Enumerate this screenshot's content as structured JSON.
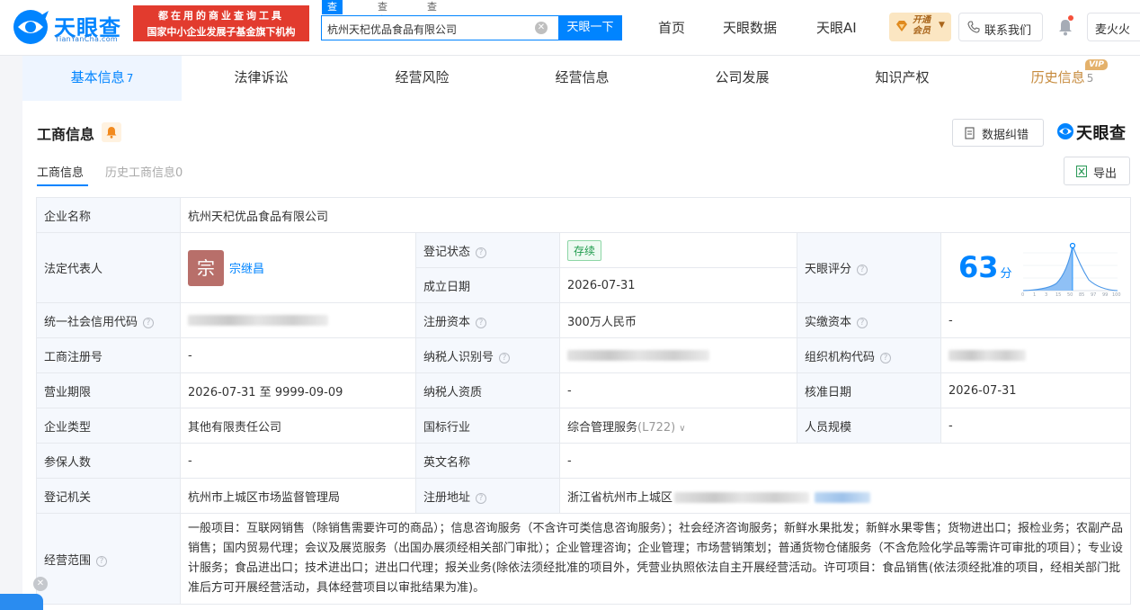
{
  "header": {
    "logo_text": "天眼查",
    "logo_sub": "TianYanCha.com",
    "slogan_line1": "都在用的商业查询工具",
    "slogan_line2": "国家中小企业发展子基金旗下机构",
    "search_tabs": [
      "查公司",
      "查老板",
      "查关系"
    ],
    "search_value": "杭州天杞优品食品有限公司",
    "search_button": "天眼一下",
    "nav": [
      "首页",
      "天眼数据",
      "天眼AI"
    ],
    "vip_label": "开通会员",
    "contact": "联系我们",
    "user": "麦火火"
  },
  "tabs": [
    {
      "label": "基本信息",
      "count": "7"
    },
    {
      "label": "法律诉讼",
      "count": ""
    },
    {
      "label": "经营风险",
      "count": ""
    },
    {
      "label": "经营信息",
      "count": ""
    },
    {
      "label": "公司发展",
      "count": ""
    },
    {
      "label": "知识产权",
      "count": ""
    },
    {
      "label": "历史信息",
      "count": "5",
      "tag": "VIP"
    }
  ],
  "section": {
    "title": "工商信息",
    "correct_button": "数据纠错",
    "brand": "天眼查",
    "sub_tabs": [
      "工商信息",
      "历史工商信息0"
    ],
    "export_button": "导出"
  },
  "info": {
    "company_name_label": "企业名称",
    "company_name": "杭州天杞优品食品有限公司",
    "legal_rep_label": "法定代表人",
    "legal_rep_avatar": "宗",
    "legal_rep": "宗继昌",
    "reg_status_label": "登记状态",
    "reg_status": "存续",
    "found_date_label": "成立日期",
    "found_date": "2026-07-31",
    "score_label": "天眼评分",
    "score": "63",
    "score_unit": "分",
    "score_axis": [
      "0",
      "1",
      "3",
      "15",
      "50",
      "85",
      "97",
      "99",
      "100"
    ],
    "credit_code_label": "统一社会信用代码",
    "reg_capital_label": "注册资本",
    "reg_capital": "300万人民币",
    "paid_capital_label": "实缴资本",
    "paid_capital": "-",
    "biz_reg_no_label": "工商注册号",
    "biz_reg_no": "-",
    "taxpayer_id_label": "纳税人识别号",
    "org_code_label": "组织机构代码",
    "biz_term_label": "营业期限",
    "biz_term": "2026-07-31 至 9999-09-09",
    "taxpayer_qual_label": "纳税人资质",
    "taxpayer_qual": "-",
    "approve_date_label": "核准日期",
    "approve_date": "2026-07-31",
    "company_type_label": "企业类型",
    "company_type": "其他有限责任公司",
    "industry_label": "国标行业",
    "industry": "综合管理服务",
    "industry_code": "(L722)",
    "staff_size_label": "人员规模",
    "staff_size": "-",
    "insured_label": "参保人数",
    "insured": "-",
    "english_name_label": "英文名称",
    "english_name": "-",
    "reg_authority_label": "登记机关",
    "reg_authority": "杭州市上城区市场监督管理局",
    "reg_address_label": "注册地址",
    "reg_address": "浙江省杭州市上城区",
    "scope_label": "经营范围",
    "scope": "一般项目：互联网销售（除销售需要许可的商品）；信息咨询服务（不含许可类信息咨询服务）；社会经济咨询服务；新鲜水果批发；新鲜水果零售；货物进出口；报检业务；农副产品销售；国内贸易代理；会议及展览服务（出国办展须经相关部门审批）；企业管理咨询；企业管理；市场营销策划；普通货物仓储服务（不含危险化学品等需许可审批的项目）；专业设计服务；食品进出口；技术进出口；进出口代理；报关业务(除依法须经批准的项目外，凭营业执照依法自主开展经营活动。许可项目：食品销售(依法须经批准的项目，经相关部门批准后方可开展经营活动，具体经营项目以审批结果为准)。"
  },
  "colors": {
    "brand_blue": "#0084ff",
    "slogan_red": "#e23b2e",
    "status_green": "#1e9b4c",
    "history_gold": "#c68a3c"
  }
}
